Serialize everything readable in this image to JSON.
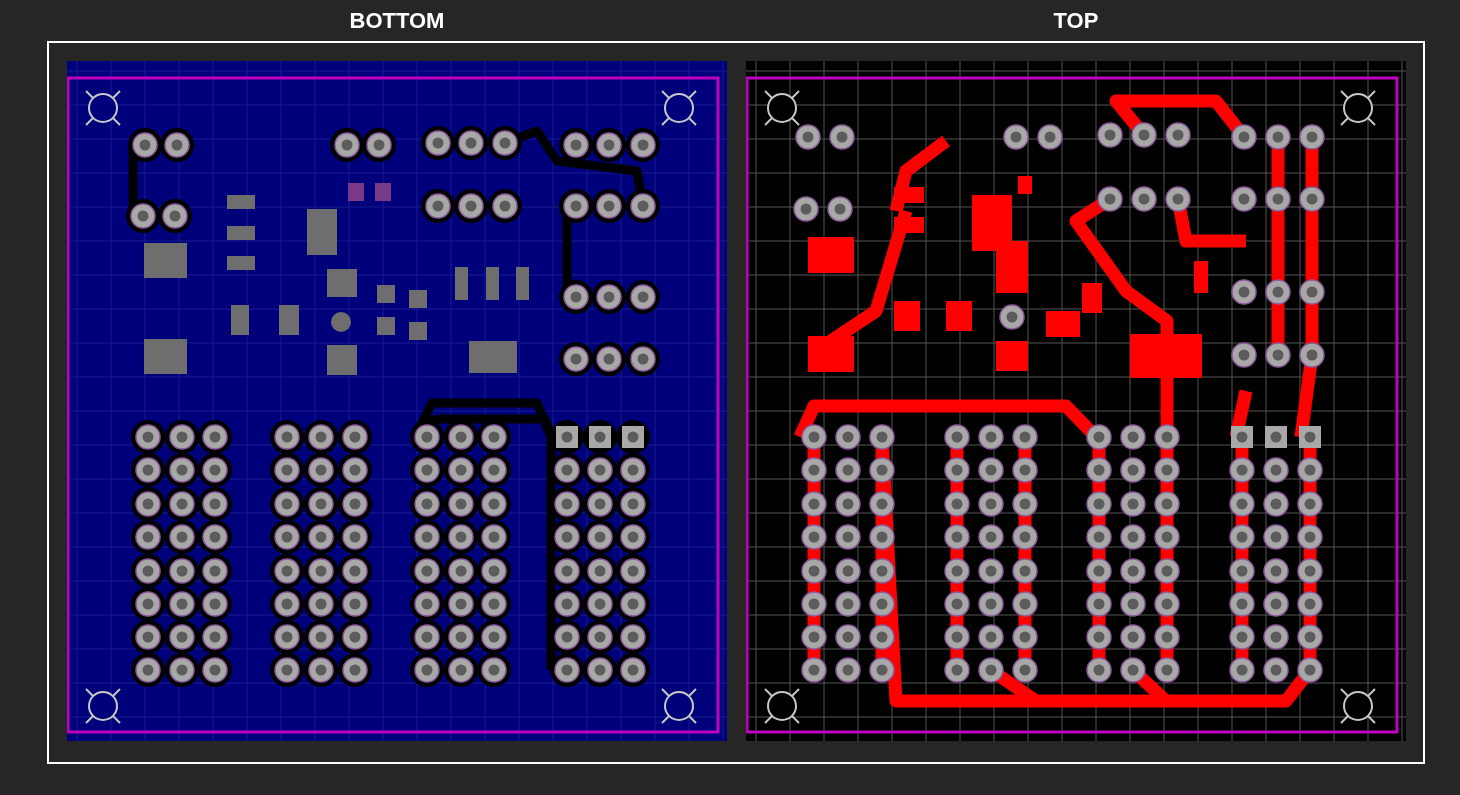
{
  "panels": [
    {
      "title": "BOTTOM",
      "kind": "bottom"
    },
    {
      "title": "TOP",
      "kind": "top"
    }
  ]
}
